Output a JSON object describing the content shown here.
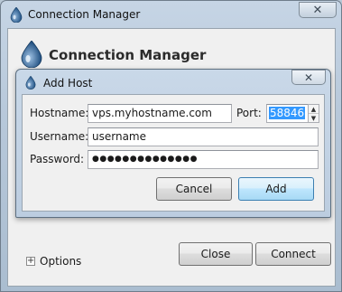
{
  "window": {
    "title": "Connection Manager",
    "close_glyph": "✕",
    "heading": "Connection Manager",
    "icon": "water-drop-icon"
  },
  "dialog": {
    "title": "Add Host",
    "close_glyph": "✕",
    "icon": "water-drop-icon",
    "hostname_label": "Hostname:",
    "hostname_value": "vps.myhostname.com",
    "port_label": "Port:",
    "port_value": "58846",
    "username_label": "Username:",
    "username_value": "username",
    "password_label": "Password:",
    "password_value": "●●●●●●●●●●●●●●",
    "cancel_label": "Cancel",
    "add_label": "Add"
  },
  "options": {
    "expander_glyph": "+",
    "label": "Options"
  },
  "footer": {
    "close_label": "Close",
    "connect_label": "Connect"
  },
  "colors": {
    "selection": "#3399ff",
    "title_bar": "#c6d5e5",
    "default_button": "#bee6fd"
  }
}
